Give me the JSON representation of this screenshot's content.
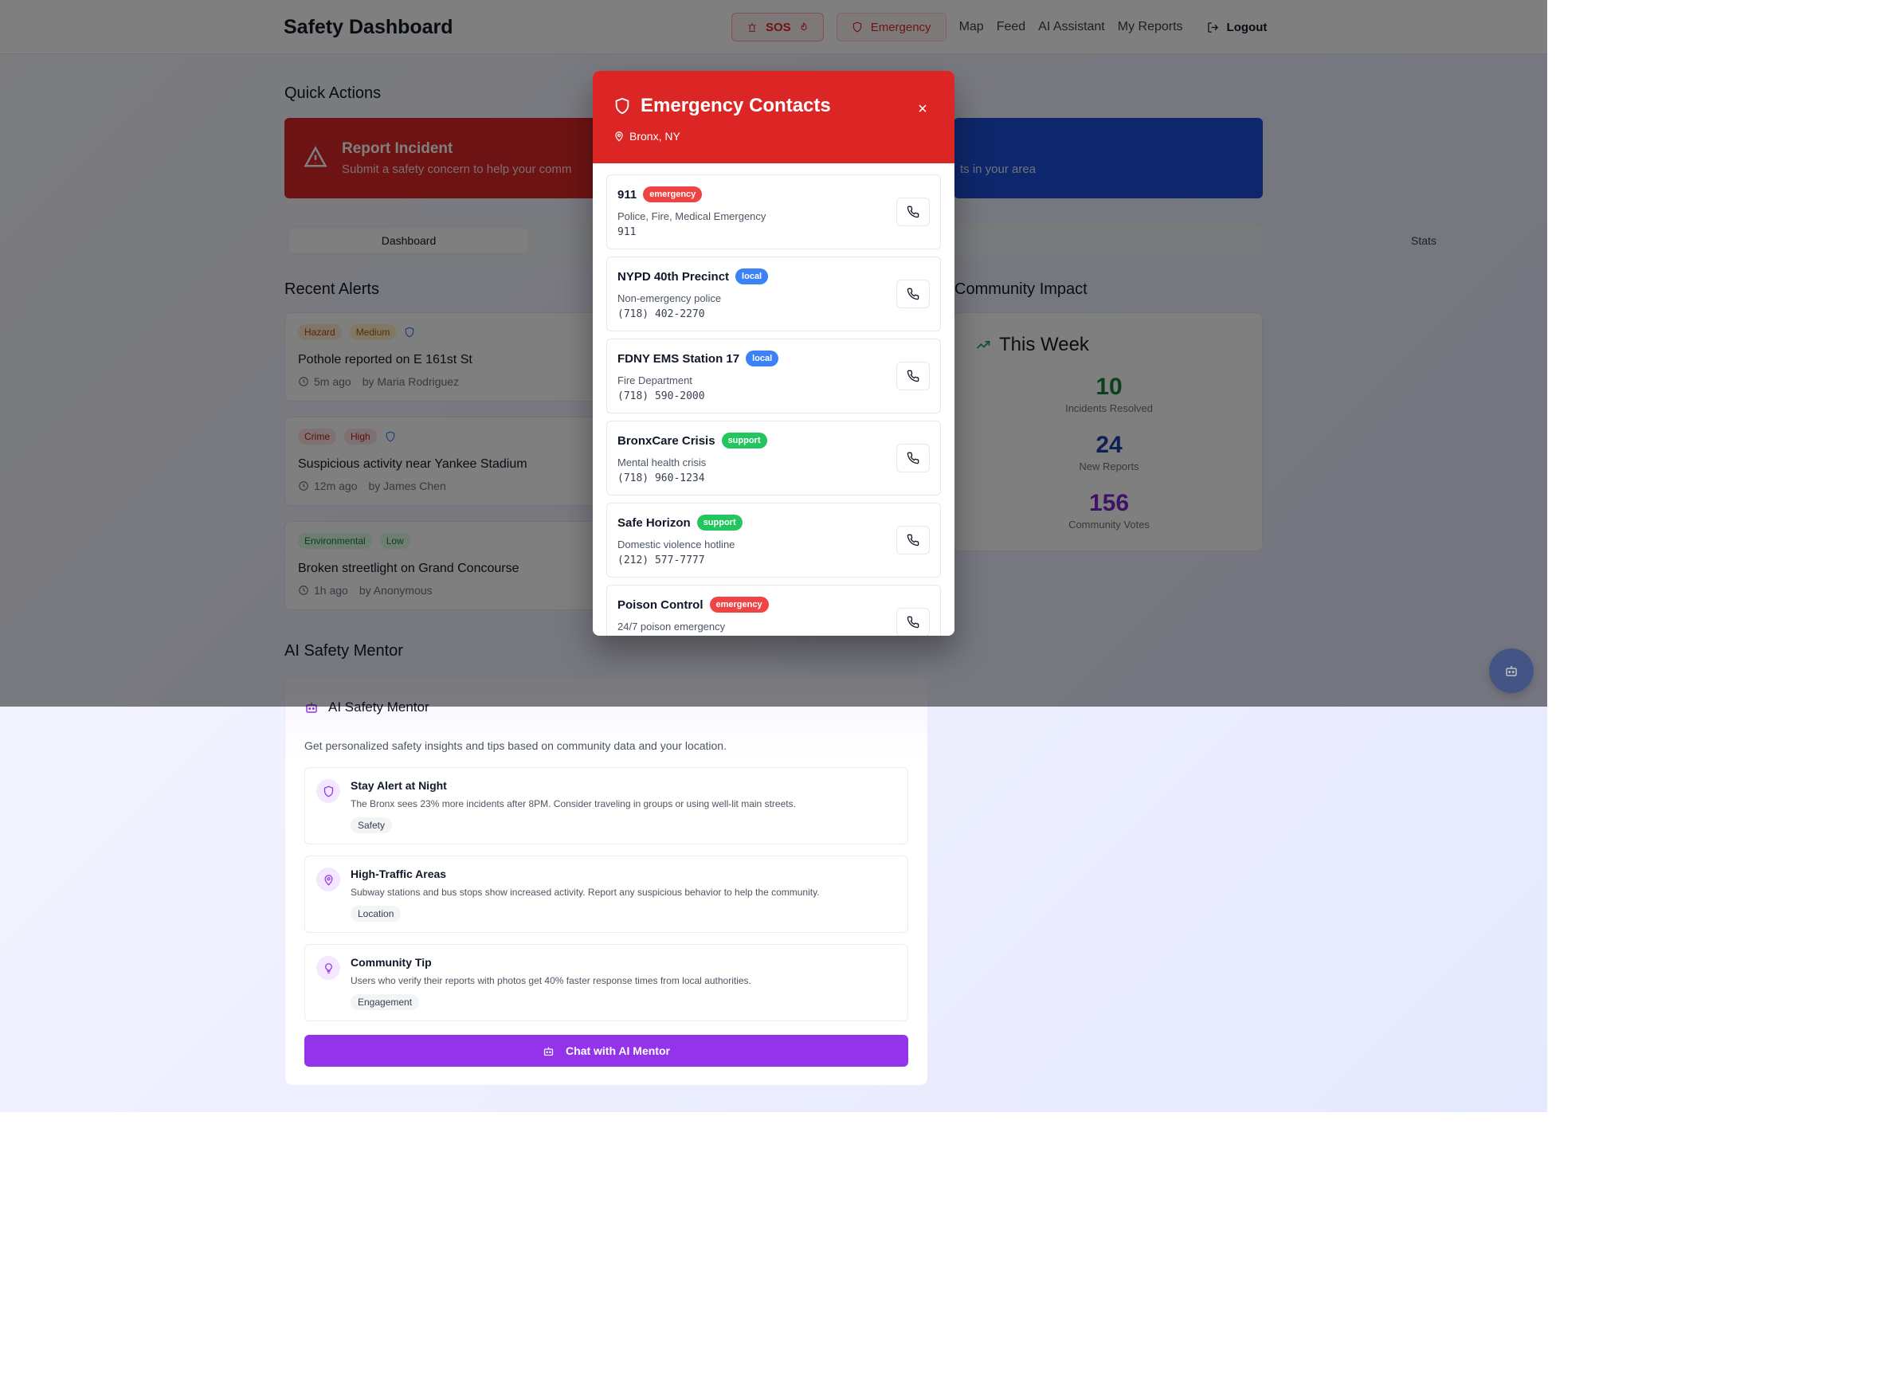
{
  "header": {
    "brand": "Safety Dashboard",
    "sos_label": "SOS",
    "emergency_label": "Emergency",
    "links": [
      "Map",
      "Feed",
      "AI Assistant",
      "My Reports"
    ],
    "logout_label": "Logout"
  },
  "quick_actions": {
    "title": "Quick Actions",
    "report": {
      "title": "Report Incident",
      "subtitle": "Submit a safety concern to help your comm"
    },
    "view": {
      "subtitle": "ts in your area"
    }
  },
  "tabs": {
    "dashboard": "Dashboard",
    "stats": "Stats"
  },
  "recent_alerts": {
    "title": "Recent Alerts",
    "items": [
      {
        "category": "Hazard",
        "severity": "Medium",
        "title": "Pothole reported on E 161st St",
        "time": "5m ago",
        "author": "by Maria Rodriguez"
      },
      {
        "category": "Crime",
        "severity": "High",
        "title": "Suspicious activity near Yankee Stadium",
        "time": "12m ago",
        "author": "by James Chen"
      },
      {
        "category": "Environmental",
        "severity": "Low",
        "title": "Broken streetlight on Grand Concourse",
        "time": "1h ago",
        "author": "by Anonymous"
      }
    ]
  },
  "community_impact": {
    "title": "Community Impact",
    "card_title": "This Week",
    "stats": [
      {
        "value": "10",
        "label": "Incidents Resolved"
      },
      {
        "value": "24",
        "label": "New Reports"
      },
      {
        "value": "156",
        "label": "Community Votes"
      }
    ]
  },
  "ai_mentor": {
    "section_title": "AI Safety Mentor",
    "card_title": "AI Safety Mentor",
    "description": "Get personalized safety insights and tips based on community data and your location.",
    "tips": [
      {
        "title": "Stay Alert at Night",
        "body": "The Bronx sees 23% more incidents after 8PM. Consider traveling in groups or using well-lit main streets.",
        "tag": "Safety"
      },
      {
        "title": "High-Traffic Areas",
        "body": "Subway stations and bus stops show increased activity. Report any suspicious behavior to help the community.",
        "tag": "Location"
      },
      {
        "title": "Community Tip",
        "body": "Users who verify their reports with photos get 40% faster response times from local authorities.",
        "tag": "Engagement"
      }
    ],
    "chat_button": "Chat with AI Mentor"
  },
  "modal": {
    "title": "Emergency Contacts",
    "location": "Bronx, NY",
    "close": "×",
    "contacts": [
      {
        "name": "911",
        "type": "emergency",
        "desc": "Police, Fire, Medical Emergency",
        "number": "911"
      },
      {
        "name": "NYPD 40th Precinct",
        "type": "local",
        "desc": "Non-emergency police",
        "number": "(718) 402-2270"
      },
      {
        "name": "FDNY EMS Station 17",
        "type": "local",
        "desc": "Fire Department",
        "number": "(718) 590-2000"
      },
      {
        "name": "BronxCare Crisis",
        "type": "support",
        "desc": "Mental health crisis",
        "number": "(718) 960-1234"
      },
      {
        "name": "Safe Horizon",
        "type": "support",
        "desc": "Domestic violence hotline",
        "number": "(212) 577-7777"
      },
      {
        "name": "Poison Control",
        "type": "emergency",
        "desc": "24/7 poison emergency",
        "number": ""
      }
    ]
  },
  "colors": {
    "brand_red": "#dc2626",
    "brand_blue": "#1d4ed8",
    "purple": "#9333ea",
    "green_stat": "#15803d",
    "blue_stat": "#1e40af",
    "purple_stat": "#7e22ce"
  }
}
